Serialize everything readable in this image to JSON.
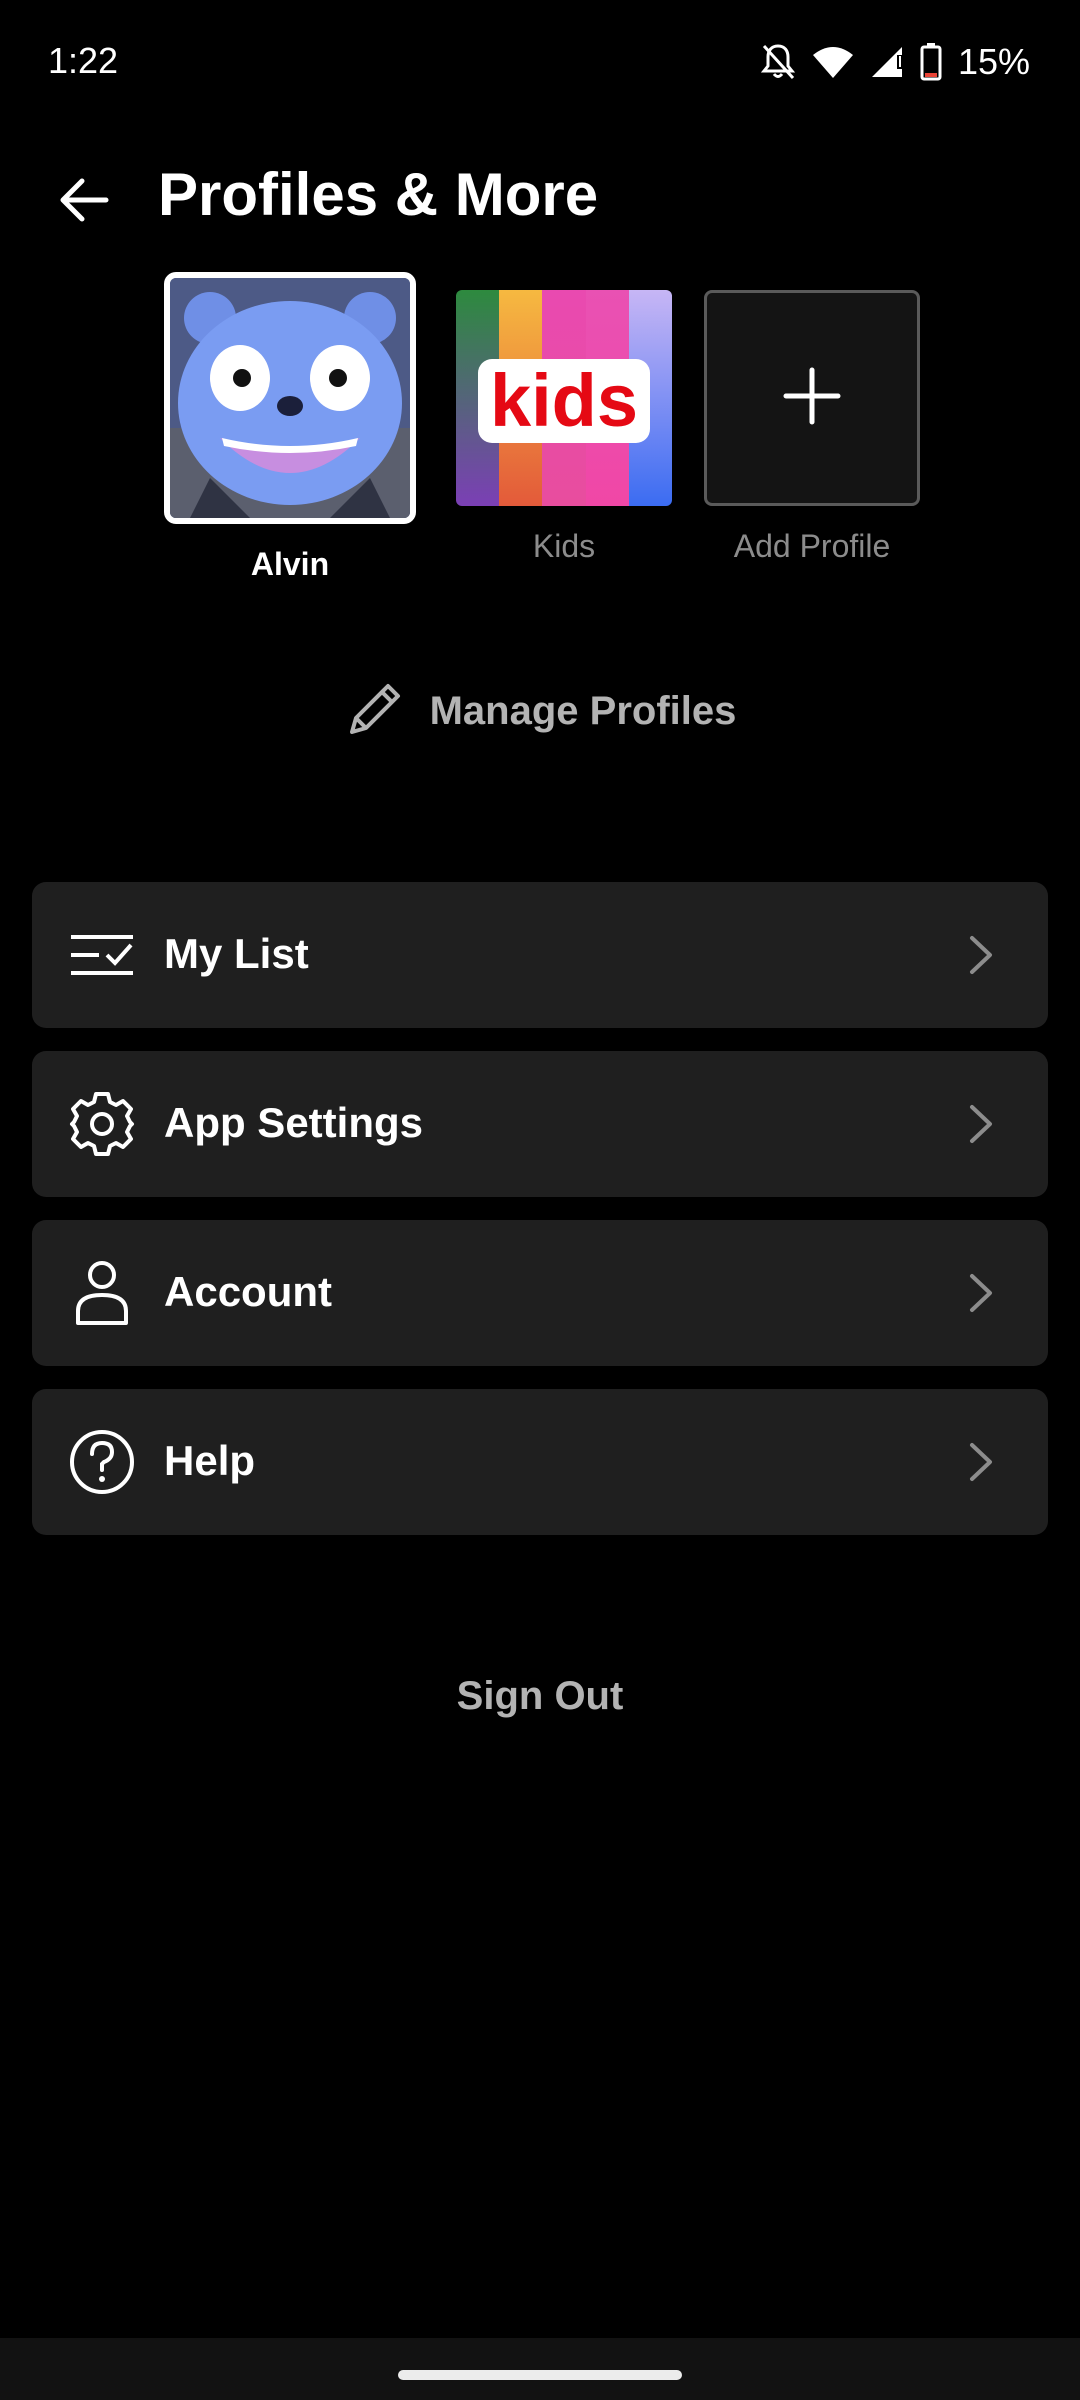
{
  "status_bar": {
    "time": "1:22",
    "battery": "15%",
    "icons": [
      "bell-off-icon",
      "wifi-icon",
      "signal-icon",
      "battery-icon"
    ]
  },
  "header": {
    "title": "Profiles & More",
    "back_icon": "arrow-left-icon"
  },
  "profiles": [
    {
      "name": "Alvin",
      "active": true
    },
    {
      "name": "Kids",
      "active": false,
      "badge_text": "kids"
    },
    {
      "name": "Add Profile",
      "active": false
    }
  ],
  "manage_profiles": {
    "label": "Manage Profiles",
    "icon": "pencil-icon"
  },
  "menu": [
    {
      "label": "My List",
      "icon": "list-check-icon"
    },
    {
      "label": "App Settings",
      "icon": "gear-icon"
    },
    {
      "label": "Account",
      "icon": "person-icon"
    },
    {
      "label": "Help",
      "icon": "help-circle-icon"
    }
  ],
  "sign_out": "Sign Out",
  "colors": {
    "background": "#000000",
    "card": "#1f1f1f",
    "muted_text": "#b3b3b3",
    "brand_red": "#e50914"
  }
}
